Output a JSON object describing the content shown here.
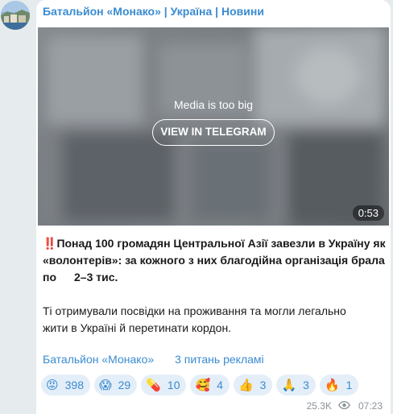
{
  "channel": {
    "title": "Батальйон «Монако» | Україна | Новини"
  },
  "media": {
    "notice": "Media is too big",
    "button_label": "VIEW IN TELEGRAM",
    "duration": "0:53"
  },
  "post": {
    "icon": "‼️",
    "headline_line1": "Понад 100 громадян Центральної Азії завезли в Україну як",
    "headline_line2": "«волонтерів»: за кожного з них благодійна організація брала",
    "headline_line3_a": "по",
    "headline_line3_b": "2–3 тис.",
    "body_line1": "Ті отримували посвідки на проживання та могли легально",
    "body_line2": "жити в Україні й перетинати кордон."
  },
  "links": {
    "channel_link": "Батальйон «Монако»",
    "ads_link": "3 питань рекламі"
  },
  "reactions": [
    {
      "icon": "angry-face-icon",
      "emoji": "😡",
      "count": "398"
    },
    {
      "icon": "screaming-face-icon",
      "emoji": "😱",
      "count": "29"
    },
    {
      "icon": "pill-icon",
      "emoji": "💊",
      "count": "10"
    },
    {
      "icon": "hearts-face-icon",
      "emoji": "🥰",
      "count": "4"
    },
    {
      "icon": "thumbs-up-icon",
      "emoji": "👍",
      "count": "3"
    },
    {
      "icon": "folded-hands-icon",
      "emoji": "🙏",
      "count": "3"
    },
    {
      "icon": "fire-icon",
      "emoji": "🔥",
      "count": "1"
    }
  ],
  "meta": {
    "views": "25.3K",
    "time": "07:23"
  },
  "colors": {
    "accent": "#3a8bd0",
    "background": "#e6ebee",
    "reaction_bg": "#e4eef8"
  }
}
